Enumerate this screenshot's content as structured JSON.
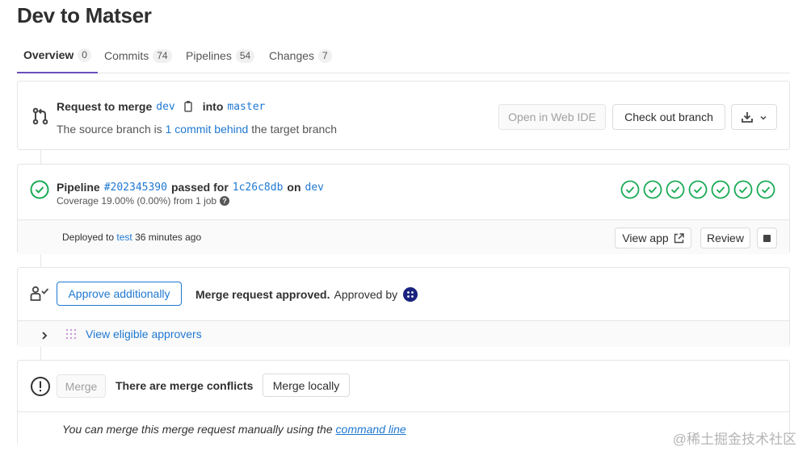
{
  "title": "Dev to Matser",
  "tabs": [
    {
      "label": "Overview",
      "count": "0"
    },
    {
      "label": "Commits",
      "count": "74"
    },
    {
      "label": "Pipelines",
      "count": "54"
    },
    {
      "label": "Changes",
      "count": "7"
    }
  ],
  "merge_info": {
    "request_label": "Request to merge",
    "source_branch": "dev",
    "into_label": "into",
    "target_branch": "master",
    "status_prefix": "The source branch is",
    "status_link": "1 commit behind",
    "status_suffix": "the target branch",
    "open_ide_label": "Open in Web IDE",
    "checkout_label": "Check out branch"
  },
  "pipeline": {
    "label": "Pipeline",
    "id": "#202345390",
    "passed_for": "passed for",
    "commit": "1c26c8db",
    "on_label": "on",
    "branch": "dev",
    "coverage": "Coverage 19.00% (0.00%) from 1 job",
    "stages_count": 7,
    "status_color": "#1aaa55",
    "deploy_prefix": "Deployed to",
    "deploy_env": "test",
    "deploy_time": "36 minutes ago",
    "view_app_label": "View app",
    "review_label": "Review"
  },
  "approval": {
    "approve_label": "Approve additionally",
    "approved_text": "Merge request approved.",
    "approved_by": "Approved by",
    "eligible_label": "View eligible approvers"
  },
  "conflict": {
    "merge_label": "Merge",
    "conflict_text": "There are merge conflicts",
    "merge_locally_label": "Merge locally",
    "manual_text": "You can merge this merge request manually using the",
    "command_line_label": "command line"
  },
  "watermark": "@稀土掘金技术社区"
}
